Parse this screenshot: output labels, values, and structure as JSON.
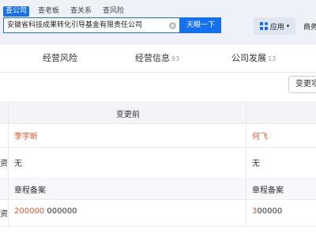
{
  "search": {
    "tabs": [
      "查公司",
      "查老板",
      "查关系",
      "查风险"
    ],
    "value": "安徽省科技成果转化引导基金有限责任公司",
    "button_label": "天眼一下"
  },
  "header": {
    "app_label": "应用",
    "biz_label": "商务"
  },
  "nav": {
    "tabs": [
      {
        "label": "经营风险",
        "count": ""
      },
      {
        "label": "经营信息",
        "count": "93"
      },
      {
        "label": "公司发展",
        "count": "13"
      }
    ]
  },
  "changes_button_label": "变更项",
  "table": {
    "header_before": "变更前",
    "rows": [
      {
        "left_label": "",
        "before": "李宇昕",
        "after": "何飞",
        "highlight": true
      },
      {
        "left_label": "资",
        "before": "无",
        "after": "无",
        "highlight": false
      },
      {
        "left_label": "",
        "before": "章程备案",
        "after": "章程备案",
        "highlight": false,
        "sub": true
      },
      {
        "left_label": "资",
        "before_parts": [
          "200000",
          " 000000"
        ],
        "after_parts": [
          "3",
          "00000"
        ],
        "highlight": false
      }
    ]
  },
  "colors": {
    "accent": "#1570ef",
    "changed_text": "#e0532f"
  }
}
